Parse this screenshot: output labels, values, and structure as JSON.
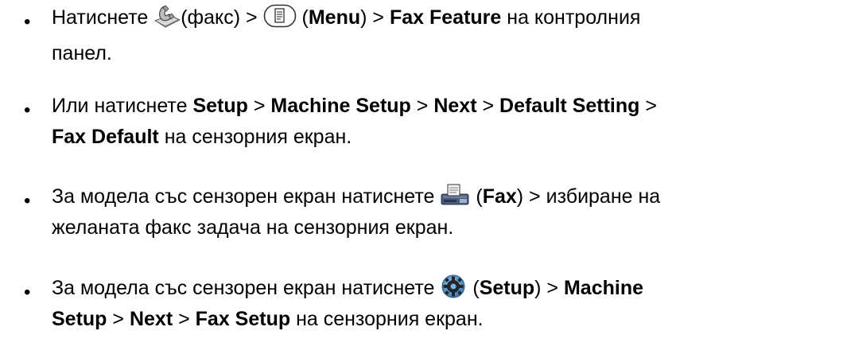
{
  "bullet_char": "•",
  "items": [
    {
      "line1": {
        "t1": "Натиснете ",
        "icon1": "fax-handset-icon",
        "t2": "(факс) > ",
        "icon2": "menu-button-icon",
        "t3": " (",
        "b1": "Menu",
        "t4": ") > ",
        "b2": "Fax Feature",
        "t5": " на контролния"
      },
      "line2": {
        "t1": "панел."
      }
    },
    {
      "line1": {
        "t1": "Или натиснете ",
        "b1": "Setup",
        "t2": " > ",
        "b2": "Machine Setup",
        "t3": " > ",
        "b3": "Next",
        "t4": " > ",
        "b4": "Default Setting",
        "t5": " >"
      },
      "line2": {
        "b1": "Fax Default",
        "t1": " на сензорния екран."
      }
    },
    {
      "line1": {
        "t1": "За модела със сензорен екран натиснете ",
        "icon1": "fax-machine-icon",
        "t2": " (",
        "b1": "Fax",
        "t3": ") > избиране на"
      },
      "line2": {
        "t1": "желаната факс задача на сензорния екран."
      }
    },
    {
      "line1": {
        "t1": "За модела със сензорен екран натиснете ",
        "icon1": "setup-gear-icon",
        "t2": " (",
        "b1": "Setup",
        "t3": ") > ",
        "b2": "Machine"
      },
      "line2": {
        "b1": "Setup",
        "t1": " > ",
        "b2": "Next",
        "t2": " > ",
        "b3": "Fax Setup",
        "t3": " на сензорния екран."
      }
    }
  ]
}
